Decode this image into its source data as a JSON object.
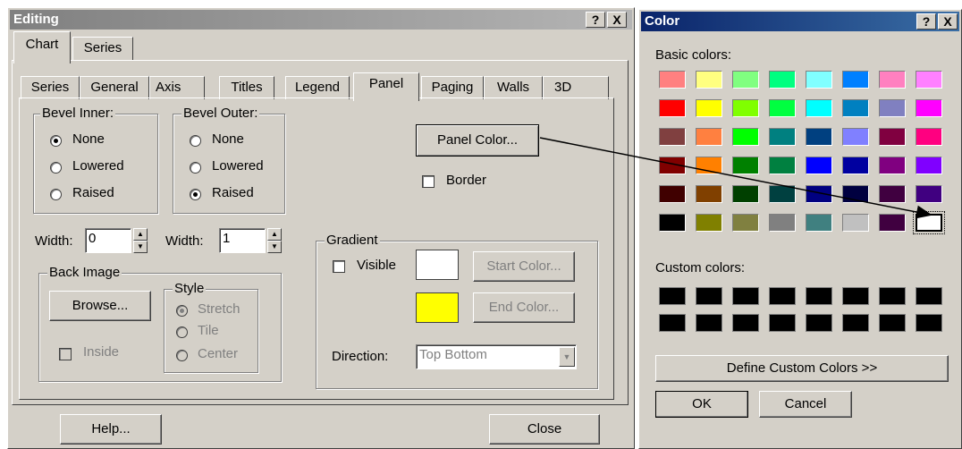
{
  "editing": {
    "title": "Editing",
    "help_glyph": "?",
    "close_glyph": "X",
    "outer_tabs": [
      "Chart",
      "Series"
    ],
    "inner_tabs": [
      "Series",
      "General",
      "Axis",
      "Titles",
      "Legend",
      "Panel",
      "Paging",
      "Walls",
      "3D"
    ],
    "bevel_inner": {
      "legend": "Bevel Inner:",
      "options": [
        "None",
        "Lowered",
        "Raised"
      ],
      "selected": "None"
    },
    "bevel_outer": {
      "legend": "Bevel Outer:",
      "options": [
        "None",
        "Lowered",
        "Raised"
      ],
      "selected": "Raised"
    },
    "panel_color_button": "Panel Color...",
    "border_label": "Border",
    "width_label_1": "Width:",
    "width_value_1": "0",
    "width_label_2": "Width:",
    "width_value_2": "1",
    "back_image": {
      "legend": "Back Image",
      "browse_button": "Browse...",
      "inside_label": "Inside"
    },
    "style": {
      "legend": "Style",
      "options": [
        "Stretch",
        "Tile",
        "Center"
      ],
      "selected": "Stretch"
    },
    "gradient": {
      "legend": "Gradient",
      "visible_label": "Visible",
      "start_color_button": "Start Color...",
      "end_color_button": "End Color...",
      "start_color": "#ffffff",
      "end_color": "#ffff00",
      "direction_label": "Direction:",
      "direction_value": "Top Bottom"
    },
    "help_button": "Help...",
    "close_button": "Close"
  },
  "color_dialog": {
    "title": "Color",
    "help_glyph": "?",
    "close_glyph": "X",
    "basic_label": "Basic colors:",
    "basic_colors": [
      [
        "#ff8080",
        "#ffff80",
        "#80ff80",
        "#00ff80",
        "#80ffff",
        "#0080ff",
        "#ff80c0",
        "#ff80ff"
      ],
      [
        "#ff0000",
        "#ffff00",
        "#80ff00",
        "#00ff40",
        "#00ffff",
        "#0080c0",
        "#8080c0",
        "#ff00ff"
      ],
      [
        "#804040",
        "#ff8040",
        "#00ff00",
        "#008080",
        "#004080",
        "#8080ff",
        "#800040",
        "#ff0080"
      ],
      [
        "#800000",
        "#ff8000",
        "#008000",
        "#008040",
        "#0000ff",
        "#0000a0",
        "#800080",
        "#8000ff"
      ],
      [
        "#400000",
        "#804000",
        "#004000",
        "#004040",
        "#000080",
        "#000040",
        "#400040",
        "#400080"
      ],
      [
        "#000000",
        "#808000",
        "#808040",
        "#808080",
        "#408080",
        "#c0c0c0",
        "#400040",
        "#ffffff"
      ]
    ],
    "custom_label": "Custom colors:",
    "define_button": "Define Custom Colors >>",
    "ok_button": "OK",
    "cancel_button": "Cancel",
    "title_color": "#0a246a"
  }
}
